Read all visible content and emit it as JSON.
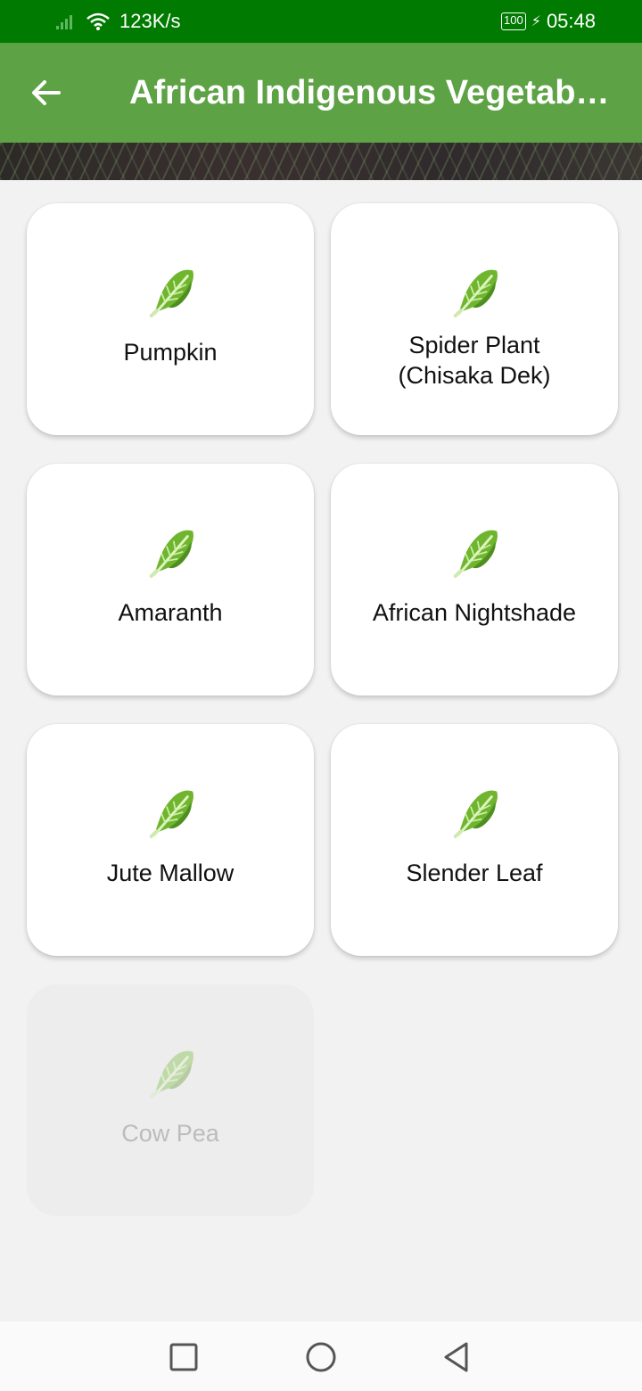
{
  "status_bar": {
    "net_speed": "123K/s",
    "battery": "100",
    "time": "05:48",
    "icons": [
      "signal-icon",
      "wifi-icon",
      "battery-icon",
      "charging-icon"
    ]
  },
  "app_bar": {
    "title": "African Indigenous Vegetable...",
    "back_icon": "arrow-left-icon"
  },
  "colors": {
    "status_bar": "#007a00",
    "app_bar": "#5da245",
    "background": "#f2f2f2",
    "card": "#ffffff"
  },
  "vegetables": [
    {
      "name": "Pumpkin",
      "icon": "leafy-green-icon",
      "enabled": true
    },
    {
      "name": "Spider Plant\n(Chisaka Dek)",
      "icon": "leafy-green-icon",
      "enabled": true
    },
    {
      "name": "Amaranth",
      "icon": "leafy-green-icon",
      "enabled": true
    },
    {
      "name": "African Nightshade",
      "icon": "leafy-green-icon",
      "enabled": true
    },
    {
      "name": "Jute Mallow",
      "icon": "leafy-green-icon",
      "enabled": true
    },
    {
      "name": "Slender Leaf",
      "icon": "leafy-green-icon",
      "enabled": true
    },
    {
      "name": "Cow Pea",
      "icon": "leafy-green-icon",
      "enabled": false
    }
  ],
  "nav_bar": {
    "icons": [
      "recents-square-icon",
      "home-circle-icon",
      "back-triangle-icon"
    ]
  }
}
